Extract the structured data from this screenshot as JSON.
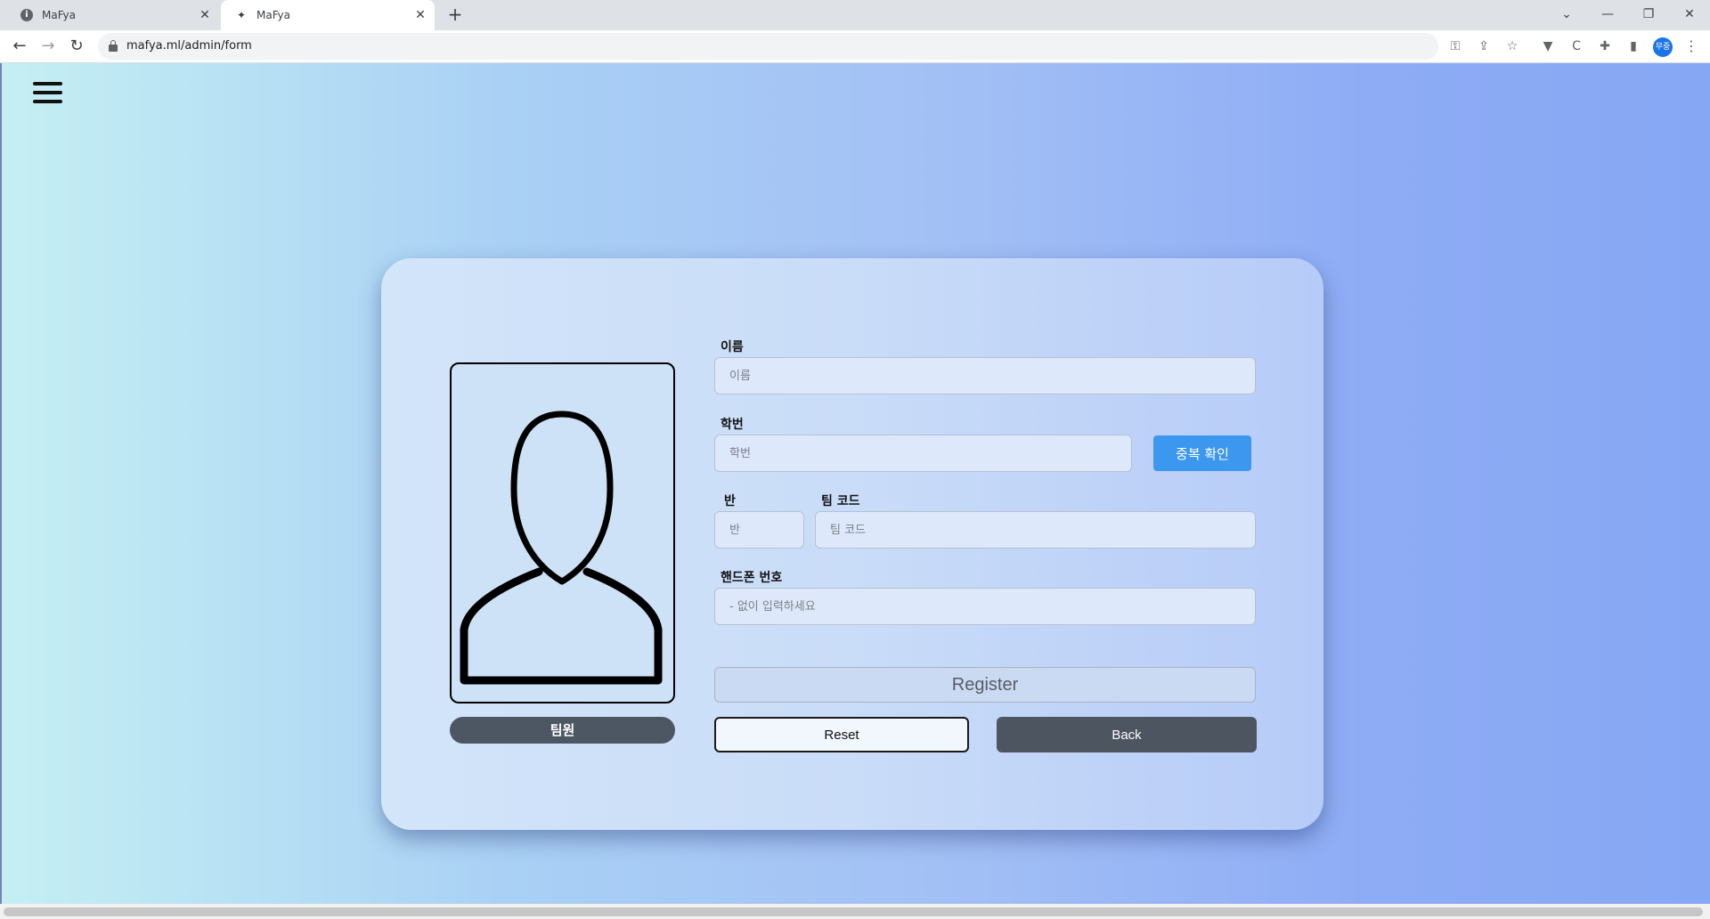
{
  "browser": {
    "tabs": [
      {
        "title": "MaFya",
        "icon": "info-icon",
        "active": false
      },
      {
        "title": "MaFya",
        "icon": "site-favicon",
        "active": true
      }
    ],
    "url": "mafya.ml/admin/form",
    "profile_initials": "무중"
  },
  "page": {
    "role_label": "팀원",
    "fields": {
      "name": {
        "label": "이름",
        "placeholder": "이름",
        "value": ""
      },
      "student_id": {
        "label": "학번",
        "placeholder": "학번",
        "value": ""
      },
      "class": {
        "label": "반",
        "placeholder": "반",
        "value": ""
      },
      "team_code": {
        "label": "팀 코드",
        "placeholder": "팀 코드",
        "value": ""
      },
      "phone": {
        "label": "핸드폰 번호",
        "placeholder": "- 없이 입력하세요",
        "value": ""
      }
    },
    "buttons": {
      "duplicate_check": "중복 확인",
      "register": "Register",
      "reset": "Reset",
      "back": "Back"
    }
  },
  "colors": {
    "accent": "#3c97ee",
    "dark_button": "#4d5561"
  }
}
